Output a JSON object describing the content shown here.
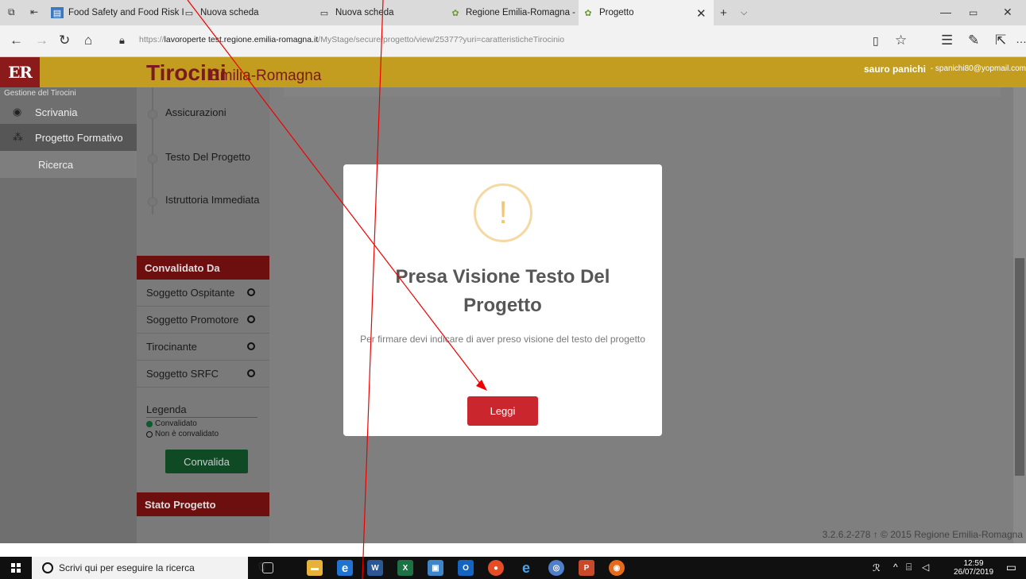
{
  "browser": {
    "tabs": [
      {
        "label": "Food Safety and Food Risk I",
        "icon": "document-icon"
      },
      {
        "label": "Nuova scheda",
        "icon": "newtab-icon"
      },
      {
        "label": "Nuova scheda",
        "icon": "newtab-icon"
      },
      {
        "label": "Regione Emilia-Romagna -",
        "icon": "er-icon"
      },
      {
        "label": "Progetto",
        "icon": "er-icon"
      }
    ],
    "url_prefix": "https://",
    "url_domain": "lavoroperte test.regione.emilia-romagna.it",
    "url_path": "/MyStage/secure/progetto/view/25377?yuri=caratteristicheTirocinio"
  },
  "app": {
    "logo": "ER",
    "title": "Tirocini",
    "subtitle": "Emilia-Romagna",
    "user_name": "sauro panichi",
    "user_email": "- spanichi80@yopmail.com"
  },
  "sidebar": {
    "section_title": "Gestione del Tirocini",
    "items": [
      {
        "label": "Scrivania",
        "icon": "dashboard-icon"
      },
      {
        "label": "Progetto Formativo",
        "icon": "cubes-icon"
      },
      {
        "label": "Ricerca"
      }
    ]
  },
  "steps": [
    {
      "label": "Assicurazioni"
    },
    {
      "label": "Testo Del Progetto"
    },
    {
      "label": "Istruttoria Immediata"
    }
  ],
  "convalidato": {
    "header": "Convalidato Da",
    "rows": [
      {
        "label": "Soggetto Ospitante"
      },
      {
        "label": "Soggetto Promotore"
      },
      {
        "label": "Tirocinante"
      },
      {
        "label": "Soggetto SRFC"
      }
    ],
    "legend_title": "Legenda",
    "legend_validated": "Convalidato",
    "legend_not_validated": "Non è convalidato",
    "button": "Convalida"
  },
  "stato": {
    "header": "Stato Progetto"
  },
  "footer": {
    "text": "3.2.6.2-278 ↑ © 2015 Regione Emilia-Romagna"
  },
  "modal": {
    "icon": "warning-icon",
    "icon_glyph": "!",
    "title": "Presa Visione Testo Del Progetto",
    "text": "Per firmare devi indicare di aver preso visione del testo del progetto",
    "button": "Leggi"
  },
  "taskbar": {
    "search_placeholder": "Scrivi qui per eseguire la ricerca",
    "time": "12:59",
    "date": "26/07/2019"
  },
  "colors": {
    "header_gold": "#c29d1f",
    "dark_red": "#6d0f0f",
    "button_red": "#c9262e",
    "warning_orange": "#f1c476"
  }
}
